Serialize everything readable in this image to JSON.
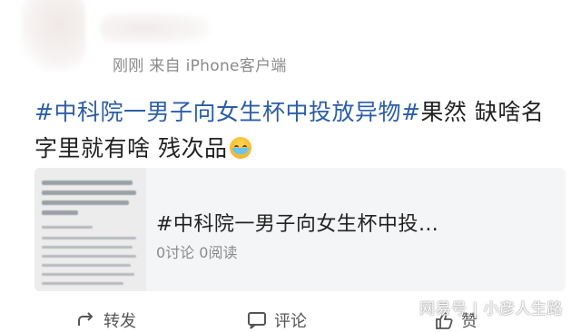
{
  "post": {
    "meta": "刚刚 来自 iPhone客户端",
    "topic": "#中科院一男子向女生杯中投放异物#",
    "text": "果然 缺啥名字里就有啥 残次品",
    "emoji": "crying-face-emoji"
  },
  "card": {
    "title": "#中科院一男子向女生杯中投…",
    "subtitle": "0讨论 0阅读"
  },
  "actions": {
    "repost": "转发",
    "comment": "评论",
    "like": "赞"
  },
  "watermark": "网易号 | 小彦人生路",
  "colors": {
    "topic": "#2b5ea8",
    "meta": "#8a8a8a",
    "card_bg": "#f4f5f7"
  }
}
